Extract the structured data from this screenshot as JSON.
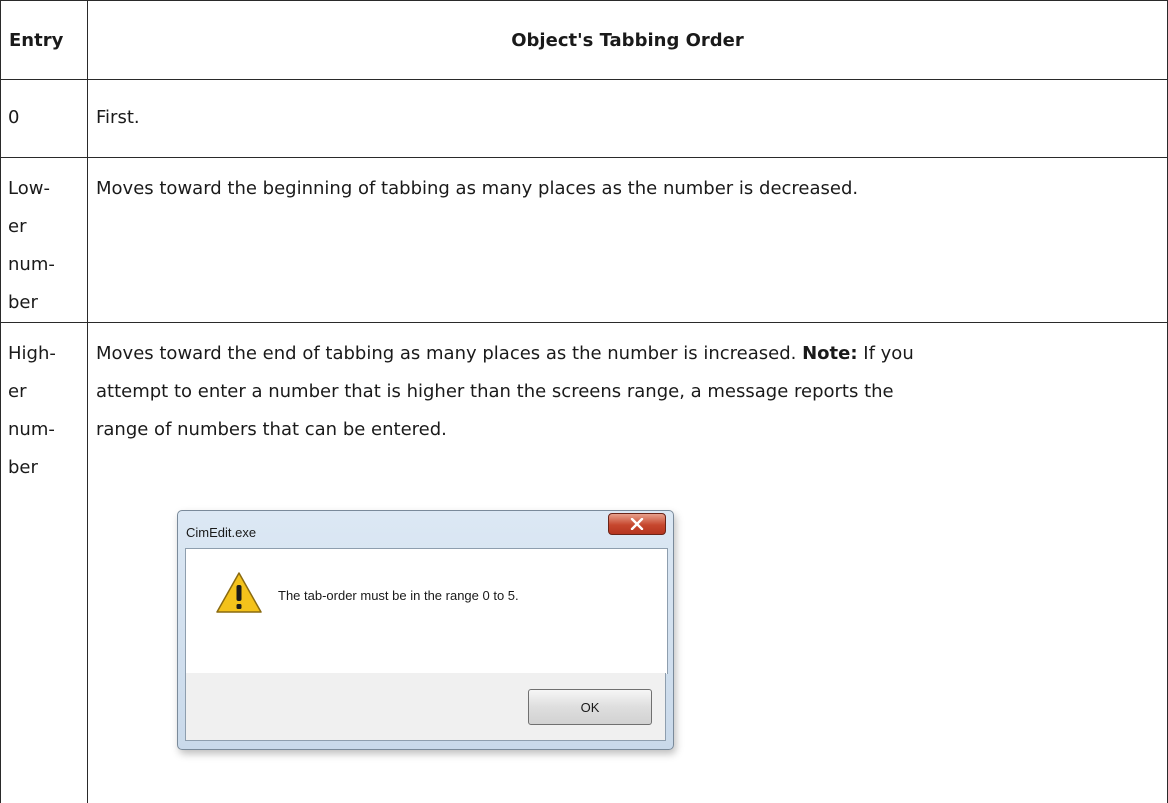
{
  "table": {
    "headers": {
      "entry": "Entry",
      "order": "Object's Tabbing Order"
    },
    "rows": [
      {
        "entry_lines": [
          "0"
        ],
        "description": "First."
      },
      {
        "entry_lines": [
          "Low-",
          "er",
          "num-",
          "ber"
        ],
        "description": "Moves toward the beginning of tabbing as many places as the number is decreased."
      },
      {
        "entry_lines": [
          "High-",
          "er",
          "num-",
          "ber"
        ],
        "description_lines": [
          "Moves toward the end of tabbing as many places as the number is increased.",
          "attempt to enter a number that is higher than the screens range, a message reports the",
          "range of numbers that can be entered."
        ],
        "note_label": "Note:",
        "note_tail": " If you"
      }
    ]
  },
  "dialog": {
    "title": "CimEdit.exe",
    "close_icon": "close-x-icon",
    "warning_icon": "warning-icon",
    "message": "The tab-order must be in the range 0 to 5.",
    "ok_label": "OK"
  },
  "colors": {
    "border": "#2a2a2a",
    "close_button": "#c6472e",
    "warning_fill": "#f4c21b"
  }
}
